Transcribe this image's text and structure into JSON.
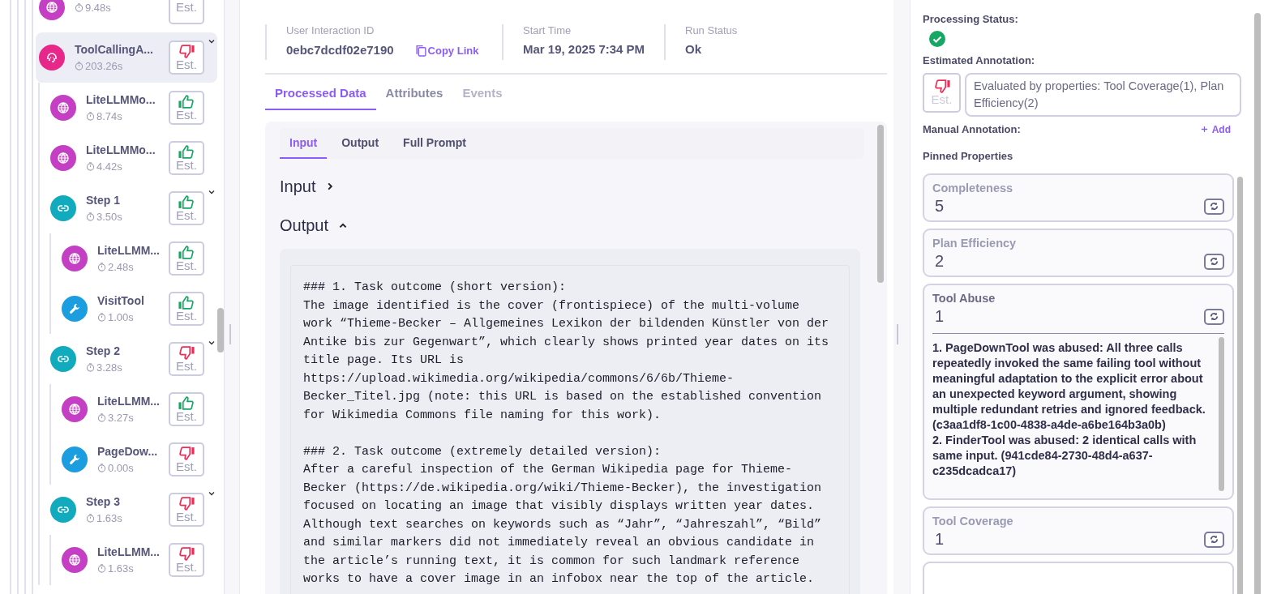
{
  "tree": [
    {
      "kind": "llm",
      "duration": "9.48s",
      "estimate_label": "Est.",
      "selected": false
    },
    {
      "kind": "agent",
      "name": "ToolCallingA...",
      "duration": "203.26s",
      "positive": false,
      "estimate_label": "Est.",
      "selected": true,
      "expanded": true,
      "children": [
        {
          "kind": "llm",
          "name": "LiteLLMMo...",
          "duration": "8.74s",
          "positive": true,
          "estimate_label": "Est.",
          "selected": false
        },
        {
          "kind": "llm",
          "name": "LiteLLMMo...",
          "duration": "4.42s",
          "positive": true,
          "estimate_label": "Est.",
          "selected": false
        },
        {
          "kind": "chain",
          "name": "Step 1",
          "duration": "3.50s",
          "positive": true,
          "estimate_label": "Est.",
          "selected": false,
          "expanded": true,
          "children": [
            {
              "kind": "llm",
              "name": "LiteLLMM...",
              "duration": "2.48s",
              "positive": true,
              "estimate_label": "Est.",
              "selected": false
            },
            {
              "kind": "tool",
              "name": "VisitTool",
              "duration": "1.00s",
              "positive": true,
              "estimate_label": "Est.",
              "selected": false
            }
          ]
        },
        {
          "kind": "chain",
          "name": "Step 2",
          "duration": "3.28s",
          "positive": false,
          "estimate_label": "Est.",
          "selected": false,
          "expanded": true,
          "children": [
            {
              "kind": "llm",
              "name": "LiteLLMM...",
              "duration": "3.27s",
              "positive": true,
              "estimate_label": "Est.",
              "selected": false
            },
            {
              "kind": "tool",
              "name": "PageDow...",
              "duration": "0.00s",
              "positive": false,
              "estimate_label": "Est.",
              "selected": false
            }
          ]
        },
        {
          "kind": "chain",
          "name": "Step 3",
          "duration": "1.63s",
          "positive": false,
          "estimate_label": "Est.",
          "selected": false,
          "expanded": true,
          "children": [
            {
              "kind": "llm",
              "name": "LiteLLMM...",
              "duration": "1.63s",
              "positive": false,
              "estimate_label": "Est.",
              "selected": false
            }
          ]
        }
      ]
    }
  ],
  "info": [
    {
      "label": "User Interaction ID",
      "value": "0ebc7dcdf02e7190",
      "link": "Copy Link"
    },
    {
      "label": "Start Time",
      "value": "Mar 19, 2025 7:34 PM"
    },
    {
      "label": "Run Status",
      "value": "Ok"
    }
  ],
  "tabs": [
    {
      "label": "Processed Data",
      "selected": true,
      "disabled": false
    },
    {
      "label": "Attributes",
      "selected": false,
      "disabled": false
    },
    {
      "label": "Events",
      "selected": false,
      "disabled": true
    }
  ],
  "subtabs": [
    {
      "label": "Input",
      "selected": true
    },
    {
      "label": "Output",
      "selected": false
    },
    {
      "label": "Full Prompt",
      "selected": false
    }
  ],
  "sections": [
    {
      "title": "Input",
      "expanded": false
    },
    {
      "title": "Output",
      "expanded": true
    }
  ],
  "output_text": "### 1. Task outcome (short version):\nThe image identified is the cover (frontispiece) of the multi-volume\nwork “Thieme-Becker – Allgemeines Lexikon der bildenden Künstler von der\nAntike bis zur Gegenwart”, which clearly shows printed year dates on its\ntitle page. Its URL is\nhttps://upload.wikimedia.org/wikipedia/commons/6/6b/Thieme-\nBecker_Titel.jpg (note: this URL is based on the established convention\nfor Wikimedia Commons file naming for this work).\n\n### 2. Task outcome (extremely detailed version):\nAfter a careful inspection of the German Wikipedia page for Thieme-\nBecker (https://de.wikipedia.org/wiki/Thieme-Becker), the investigation\nfocused on locating an image that visibly displays written year dates.\nAlthough text searches on keywords such as “Jahr”, “Jahreszahl”, “Bild”\nand similar markers did not immediately reveal an obvious candidate in\nthe article’s running text, it is common for such landmark reference\nworks to have a cover image in an infobox near the top of the article.",
  "side": {
    "processing_label": "Processing Status:",
    "processing_ok": true,
    "estimated_label": "Estimated Annotation:",
    "estimated_positive": false,
    "estimate_label": "Est.",
    "estimated_text": "Evaluated by properties: Tool Coverage(1), Plan Efficiency(2)",
    "manual_label": "Manual Annotation:",
    "add_label": "Add",
    "pinned_label": "Pinned Properties",
    "properties": [
      {
        "name": "Completeness",
        "value": "5"
      },
      {
        "name": "Plan Efficiency",
        "value": "2"
      },
      {
        "name": "Tool Abuse",
        "value": "1",
        "reason": "1. PageDownTool was abused: All three calls repeatedly invoked the same failing tool without meaningful adaptation to the explicit error about an unexpected keyword argument, showing multiple redundant retries and ignored feedback. (c3aa1df8-1c00-4838-a4de-a6be164b3a0b)\n2. FinderTool was abused: 2 identical calls with same input. (941cde84-2730-48d4-a637-c235dcadca17)"
      },
      {
        "name": "Tool Coverage",
        "value": "1"
      }
    ]
  }
}
